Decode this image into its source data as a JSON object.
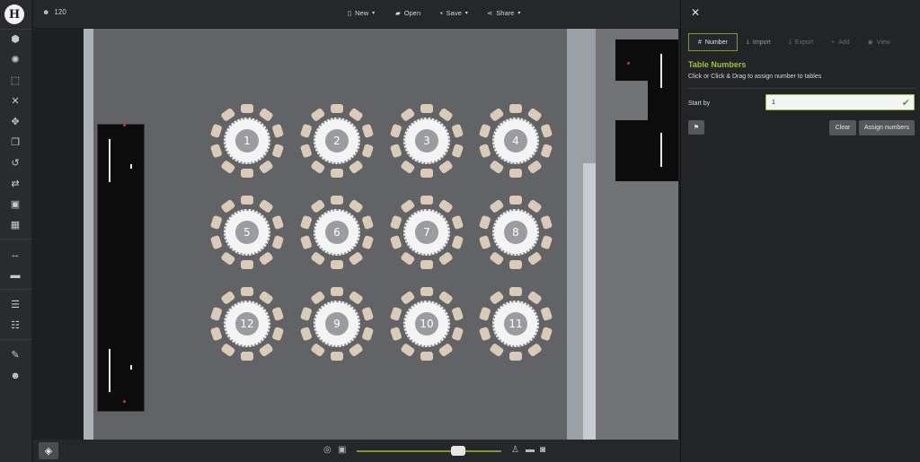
{
  "topbar": {
    "guest_count": "120",
    "new_label": "New",
    "open_label": "Open",
    "save_label": "Save",
    "share_label": "Share"
  },
  "left_toolbar": {
    "logo_text": "H",
    "icons": [
      "cube-icon",
      "palette-icon",
      "select-area-icon",
      "close-icon",
      "move-icon",
      "copy-icon",
      "rotate-icon",
      "swap-icon",
      "image-icon",
      "trash-icon",
      "measure-icon",
      "ruler-icon",
      "align-top-icon",
      "align-bottom-icon",
      "edit-icon",
      "guests-icon"
    ]
  },
  "tables": [
    "1",
    "2",
    "3",
    "4",
    "5",
    "6",
    "7",
    "8",
    "12",
    "9",
    "10",
    "11"
  ],
  "panel": {
    "tabs": [
      {
        "label": "Number",
        "icon": "#",
        "state": "active"
      },
      {
        "label": "Import",
        "icon": "⤓",
        "state": "normal"
      },
      {
        "label": "Export",
        "icon": "⤓",
        "state": "disabled"
      },
      {
        "label": "Add",
        "icon": "+",
        "state": "disabled"
      },
      {
        "label": "View",
        "icon": "◉",
        "state": "disabled"
      }
    ],
    "title": "Table Numbers",
    "description": "Click or Click & Drag to assign number to tables",
    "start_label": "Start by",
    "start_value": "1",
    "clear_label": "Clear",
    "assign_label": "Assign numbers"
  },
  "colors": {
    "accent": "#9cc23a",
    "panel_bg": "#232426",
    "floor": "#616366"
  }
}
